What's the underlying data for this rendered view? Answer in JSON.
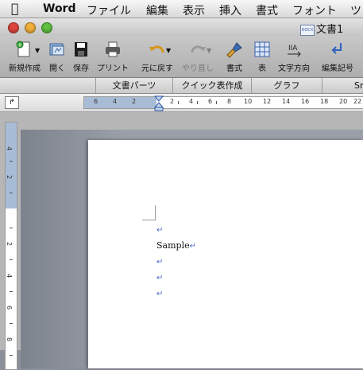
{
  "menubar": {
    "app_name": "Word",
    "items": [
      "ファイル",
      "編集",
      "表示",
      "挿入",
      "書式",
      "フォント",
      "ツ"
    ]
  },
  "window": {
    "document_title": "文書1",
    "doc_badge": "DOCX"
  },
  "toolbar": {
    "buttons": [
      {
        "label": "新規作成",
        "icon": "new-document-icon",
        "enabled": true
      },
      {
        "label": "開く",
        "icon": "open-folder-icon",
        "enabled": true
      },
      {
        "label": "保存",
        "icon": "save-icon",
        "enabled": true
      },
      {
        "label": "プリント",
        "icon": "print-icon",
        "enabled": true
      },
      {
        "label": "元に戻す",
        "icon": "undo-icon",
        "enabled": true
      },
      {
        "label": "やり直し",
        "icon": "redo-icon",
        "enabled": false
      },
      {
        "label": "書式",
        "icon": "format-brush-icon",
        "enabled": true
      },
      {
        "label": "表",
        "icon": "table-icon",
        "enabled": true
      },
      {
        "label": "文字方向",
        "icon": "text-direction-icon",
        "enabled": true
      },
      {
        "label": "編集記号",
        "icon": "paragraph-marks-icon",
        "enabled": true
      }
    ]
  },
  "ribbon": {
    "tabs": [
      "文書パーツ",
      "クイック表作成",
      "グラフ",
      "Sm"
    ]
  },
  "ruler": {
    "horizontal_numbers": [
      "6",
      "4",
      "2",
      "2",
      "4",
      "6",
      "8",
      "10",
      "12",
      "14",
      "16",
      "18",
      "20",
      "22"
    ],
    "vertical_numbers": [
      "4",
      "2",
      "2",
      "4",
      "6",
      "8"
    ],
    "tab_selector": "↱"
  },
  "document": {
    "paragraphs": [
      "",
      "Sample",
      "",
      "",
      ""
    ],
    "paragraph_mark": "↵"
  },
  "colors": {
    "ruler_margin": "#a9bcd6",
    "paragraph_mark": "#4b6cc9",
    "close_light": "#e0443e",
    "minimize_light": "#f2b03b",
    "zoom_light": "#5fbf40"
  }
}
